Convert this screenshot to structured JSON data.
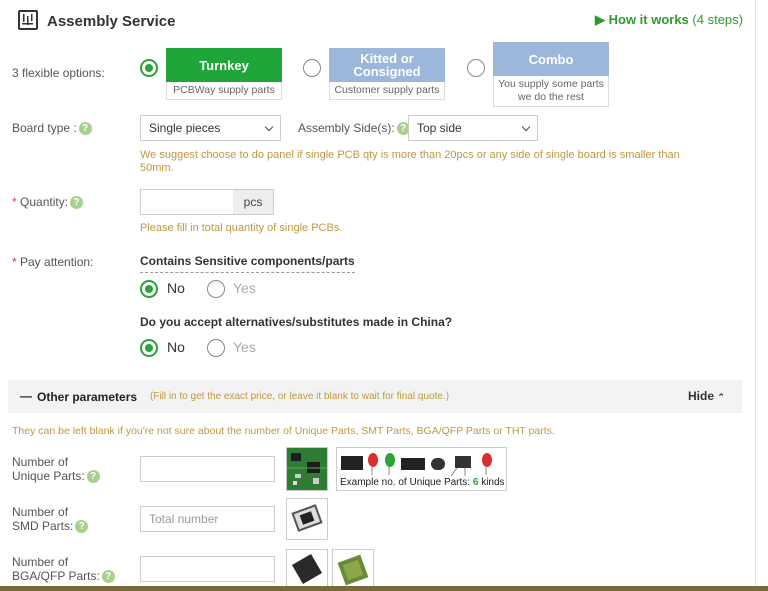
{
  "header": {
    "title": "Assembly Service",
    "how_it_works_label": "▶ How it works",
    "how_it_works_steps": "(4 steps)"
  },
  "options": {
    "label": "3 flexible options:",
    "items": [
      {
        "title": "Turnkey",
        "subtitle": "PCBWay supply parts",
        "selected": true,
        "color": "#1fa63a"
      },
      {
        "title_line1": "Kitted or",
        "title_line2": "Consigned",
        "subtitle": "Customer supply parts",
        "selected": false,
        "color": "#9bb7dc"
      },
      {
        "title": "Combo",
        "subtitle_line1": "You supply some parts",
        "subtitle_line2": "we do the rest",
        "selected": false,
        "color": "#9bb7dc"
      }
    ]
  },
  "board_type": {
    "label": "Board type :",
    "value": "Single pieces",
    "assembly_side_label": "Assembly Side(s):",
    "assembly_side_value": "Top side",
    "tip_line1": "We suggest choose to do panel if single PCB qty is more than 20pcs or any side of single board is smaller than",
    "tip_line2": "50mm."
  },
  "quantity": {
    "required_mark": "*",
    "label": " Quantity:",
    "value": "",
    "unit": "pcs",
    "tip": "Please fill in total quantity of single PCBs."
  },
  "pay_attention": {
    "required_mark": "*",
    "label": " Pay attention:",
    "q1": "Contains Sensitive components/parts",
    "q1_yes": "Yes",
    "q1_no": "No",
    "q1_selected": "No",
    "q2": "Do you accept alternatives/substitutes made in China?",
    "q2_yes": "Yes",
    "q2_no": "No",
    "q2_selected": "No"
  },
  "other_params": {
    "dash": "—",
    "title": "Other parameters",
    "hint": "(Fill in to get the exact price, or leave it blank to wait for final quote.)",
    "hide_label": "Hide",
    "note": "They can be left blank if you're not sure about the number of Unique Parts, SMT Parts, BGA/QFP Parts or THT parts.",
    "unique_label_1": "Number of",
    "unique_label_2": "Unique Parts:",
    "unique_value": "",
    "example_text": "Example no. of Unique Parts: ",
    "example_num": "6",
    "example_suffix": " kinds",
    "smd_label_1": "Number of",
    "smd_label_2": "SMD Parts:",
    "smd_placeholder": "Total number",
    "bga_label_1": "Number of",
    "bga_label_2": "BGA/QFP Parts:",
    "bga_value": ""
  },
  "colors": {
    "accent": "#1fa63a",
    "secondary": "#9bb7dc",
    "tip": "#c09840"
  }
}
